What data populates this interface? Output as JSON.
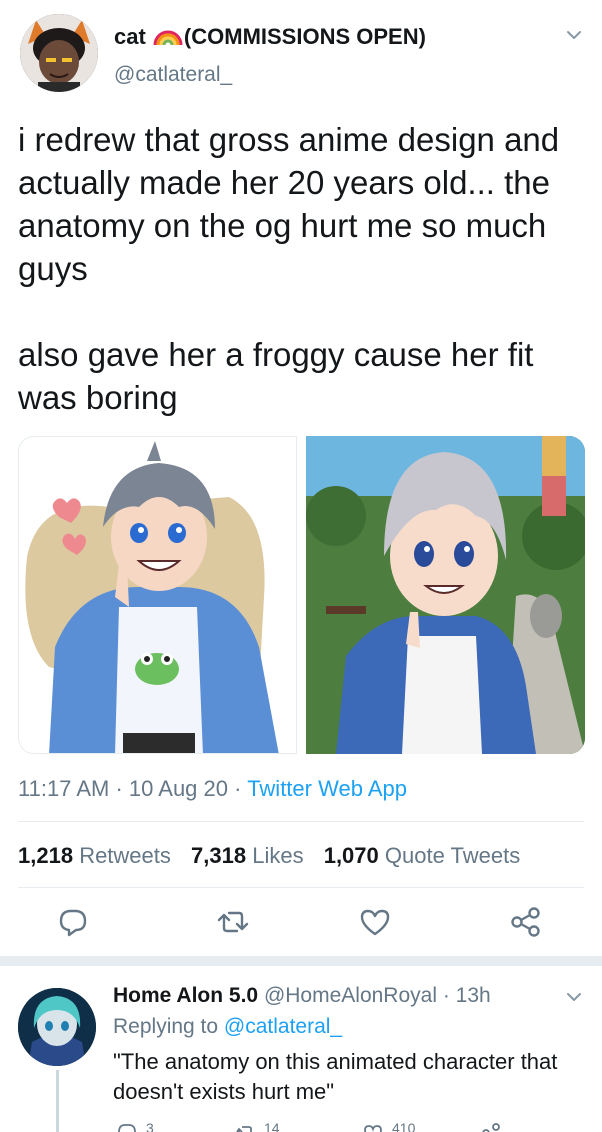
{
  "tweet": {
    "display_name": "cat",
    "name_suffix": "(COMMISSIONS OPEN)",
    "handle": "@catlateral_",
    "text": "i redrew that gross anime design and actually made her 20 years old... the anatomy on the og hurt me so much guys\n\nalso gave her a froggy cause her fit was boring",
    "time": "11:17 AM",
    "date": "10 Aug 20",
    "source": "Twitter Web App",
    "retweets_count": "1,218",
    "retweets_label": "Retweets",
    "likes_count": "7,318",
    "likes_label": "Likes",
    "quotes_count": "1,070",
    "quotes_label": "Quote Tweets",
    "icons": [
      "chevron-down-icon",
      "reply-icon",
      "retweet-icon",
      "like-icon",
      "share-icon"
    ]
  },
  "reply": {
    "display_name": "Home Alon 5.0",
    "handle": "@HomeAlonRoyal",
    "age": "13h",
    "replying_label": "Replying to",
    "replying_to": "@catlateral_",
    "text": "\"The anatomy on this animated character that doesn't exists hurt me\"",
    "counts": [
      "3",
      "14",
      "410"
    ]
  },
  "colors": {
    "text": "#14171a",
    "secondary": "#657786",
    "link": "#1da1f2",
    "divider": "#e6ecf0"
  }
}
